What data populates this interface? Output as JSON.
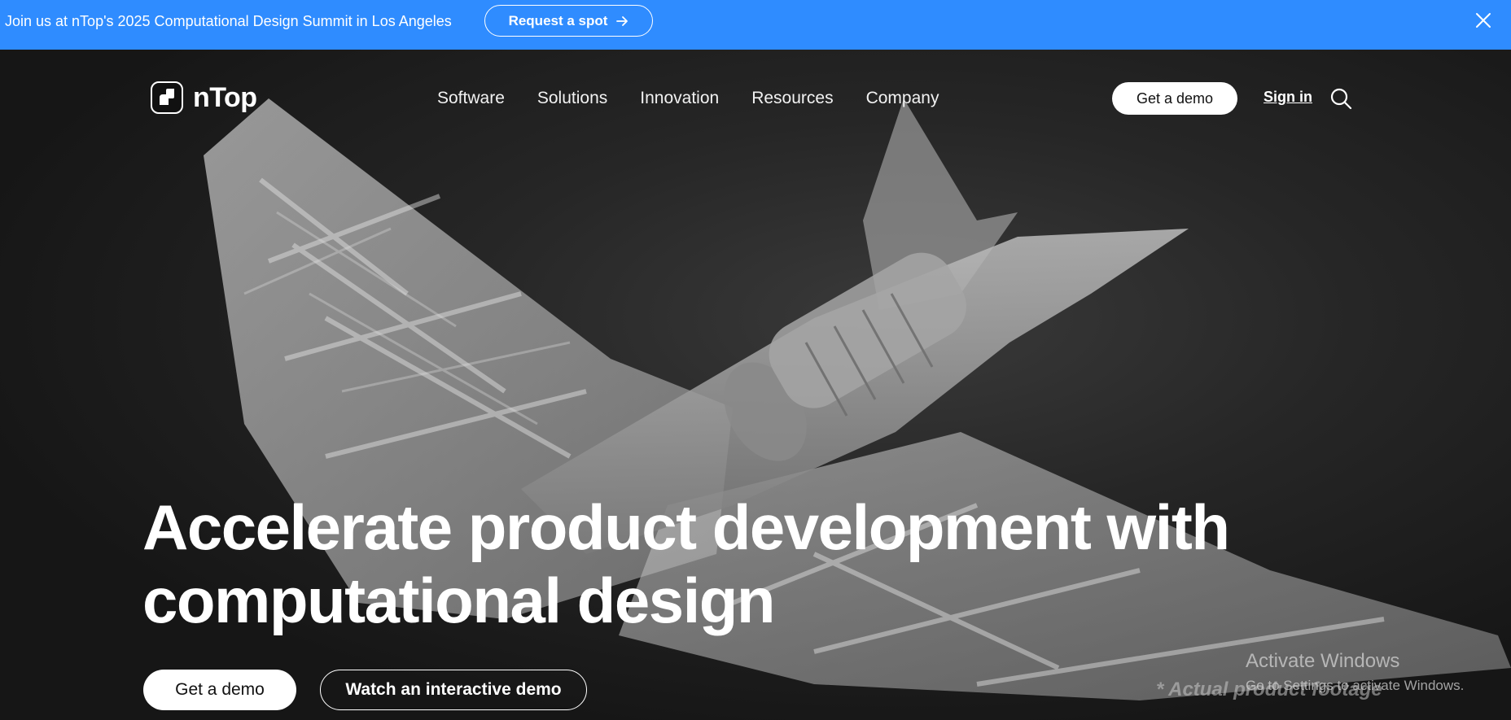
{
  "announcement": {
    "text": "Join us at nTop's 2025 Computational Design Summit in Los Angeles",
    "button_label": "Request a spot",
    "button_icon": "arrow-right-icon",
    "close_icon": "close-icon"
  },
  "header": {
    "logo_text": "nTop",
    "nav": [
      "Software",
      "Solutions",
      "Innovation",
      "Resources",
      "Company"
    ],
    "demo_label": "Get a demo",
    "signin_label": "Sign in",
    "search_icon": "search-icon"
  },
  "hero": {
    "headline_line1": "Accelerate product development with",
    "headline_line2": "computational design",
    "cta_primary": "Get a demo",
    "cta_secondary": "Watch an interactive demo",
    "footnote": "* Actual product footage"
  },
  "windows_watermark": {
    "title": "Activate Windows",
    "subtitle": "Go to Settings to activate Windows."
  },
  "colors": {
    "announcement_bg": "#2f8cff",
    "hero_bg": "#1b1b1b"
  }
}
